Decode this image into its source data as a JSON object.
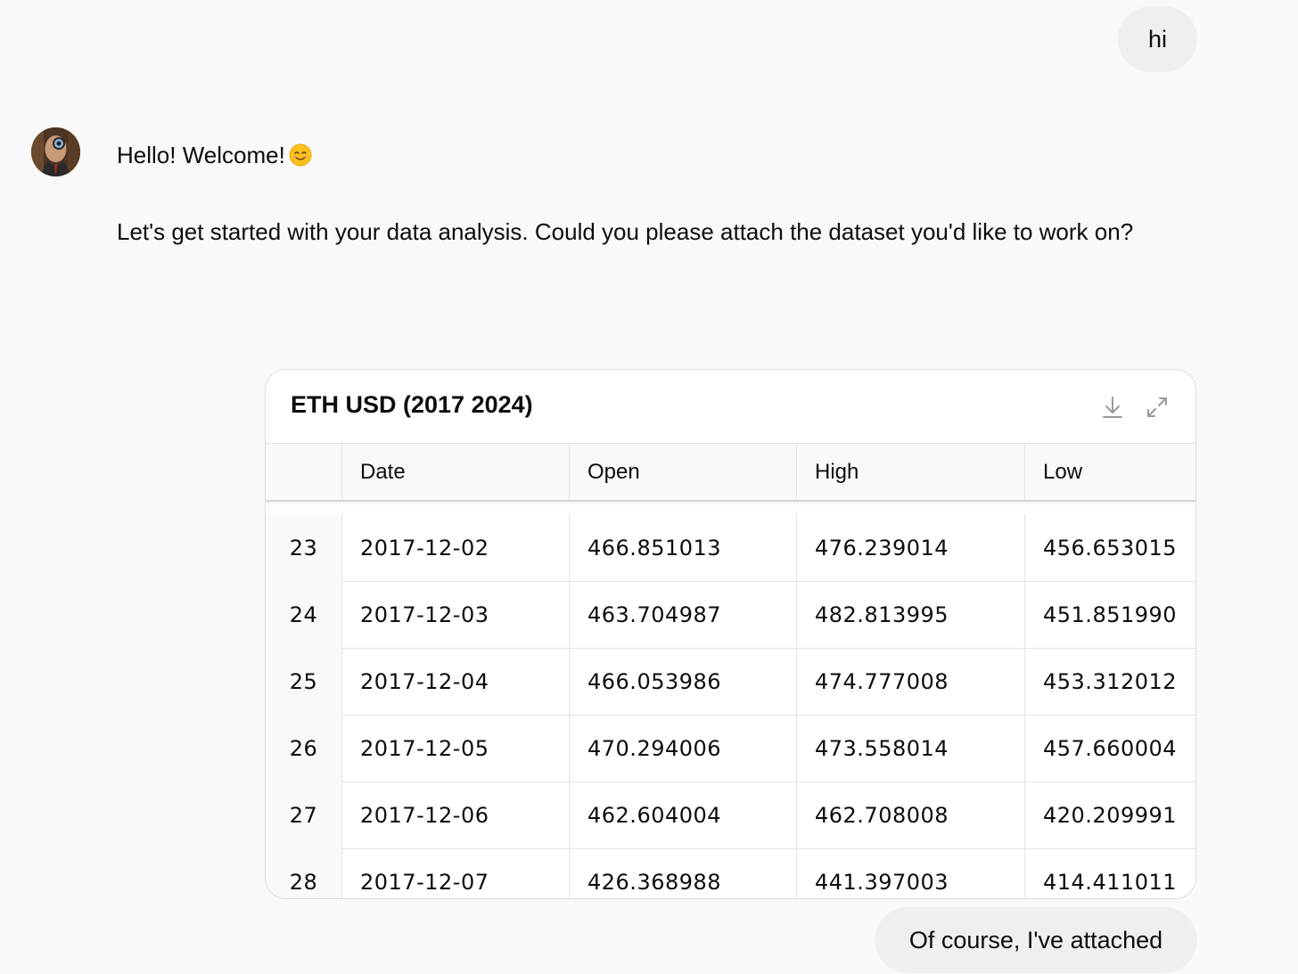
{
  "conversation": {
    "user_message_1": "hi",
    "assistant": {
      "greeting": "Hello! Welcome!",
      "greeting_emoji": "smiling-face-icon",
      "body": "Let's get started with your data analysis. Could you please attach the dataset you'd like to work on?"
    },
    "user_message_2": "Of course, I've attached"
  },
  "table_card": {
    "title": "ETH USD (2017 2024)",
    "icons": [
      "download-icon",
      "expand-icon"
    ],
    "columns": [
      "",
      "Date",
      "Open",
      "High",
      "Low"
    ],
    "rows": [
      {
        "index": "23",
        "date": "2017-12-02",
        "open": "466.851013",
        "high": "476.239014",
        "low": "456.653015"
      },
      {
        "index": "24",
        "date": "2017-12-03",
        "open": "463.704987",
        "high": "482.813995",
        "low": "451.851990"
      },
      {
        "index": "25",
        "date": "2017-12-04",
        "open": "466.053986",
        "high": "474.777008",
        "low": "453.312012"
      },
      {
        "index": "26",
        "date": "2017-12-05",
        "open": "470.294006",
        "high": "473.558014",
        "low": "457.660004"
      },
      {
        "index": "27",
        "date": "2017-12-06",
        "open": "462.604004",
        "high": "462.708008",
        "low": "420.209991"
      },
      {
        "index": "28",
        "date": "2017-12-07",
        "open": "426.368988",
        "high": "441.397003",
        "low": "414.411011"
      }
    ]
  }
}
